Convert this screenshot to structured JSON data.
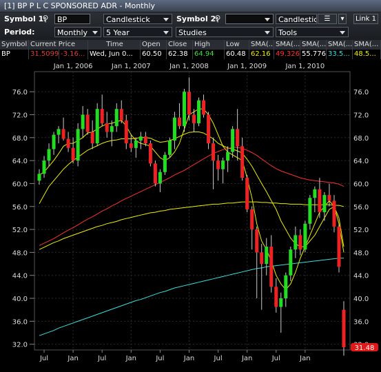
{
  "window": {
    "title": "[1] BP P L C SPONSORED ADR - Monthly"
  },
  "toolbar": {
    "symbol1_label": "Symbol 1:",
    "symbol1_value": "BP",
    "chart_type_1": "Candlestick",
    "symbol2_label": "Symbol 2:",
    "symbol2_value": "",
    "chart_type_2": "Candlestick",
    "link_label": "Link 1",
    "period_label": "Period:",
    "period_value": "Monthly",
    "range_value": "5 Year",
    "studies_label": "Studies",
    "tools_label": "Tools"
  },
  "quote_table": {
    "headers": [
      "Symbol",
      "Current Price",
      "Time",
      "Open",
      "Close",
      "High",
      "Low",
      "SMA(...",
      "SMA(...",
      "SMA(...",
      "SMA(...",
      "SMA(..."
    ],
    "values": [
      "BP",
      "31.5099",
      "-3.16...",
      "Wed, Jun 0...",
      "60.50",
      "62.38",
      "64.94",
      "60.48",
      "62.16",
      "49.326",
      "55.776",
      "33.5...",
      "48.5..."
    ],
    "colors": {
      "price": "#e23b3b",
      "change": "#e23b3b",
      "high": "#3fe03f",
      "sma1": "#f0f000",
      "sma2": "#ff3030",
      "sma4": "#38e0e0",
      "sma5": "#f0f000"
    }
  },
  "chart_data": {
    "type": "candlestick",
    "symbol": "BP",
    "period": "Monthly",
    "top_axis_labels": [
      "Jan 1, 2006",
      "Jan 1, 2007",
      "Jan 1, 2008",
      "Jan 1, 2009",
      "Jan 1, 2010"
    ],
    "bottom_axis_labels": [
      "Jul",
      "Jan",
      "Jul",
      "Jan",
      "Jul",
      "Jan",
      "Jul",
      "Jan",
      "Jul",
      "Jan"
    ],
    "y_ticks": [
      32.0,
      36.0,
      40.0,
      44.0,
      48.0,
      52.0,
      56.0,
      60.0,
      64.0,
      68.0,
      72.0,
      76.0
    ],
    "ylim": [
      31.0,
      79.5
    ],
    "current_price_label": "31.48",
    "grid": true,
    "candles": [
      [
        60.5,
        62.5,
        59.8,
        61.7
      ],
      [
        61.7,
        64.8,
        61.0,
        64.0
      ],
      [
        64.0,
        67.0,
        63.0,
        66.0
      ],
      [
        66.0,
        69.0,
        65.0,
        68.5
      ],
      [
        68.5,
        70.0,
        67.0,
        69.5
      ],
      [
        69.5,
        71.5,
        67.5,
        67.8
      ],
      [
        67.8,
        69.0,
        65.5,
        66.2
      ],
      [
        66.2,
        68.0,
        63.5,
        64.0
      ],
      [
        64.0,
        70.5,
        63.0,
        69.5
      ],
      [
        69.5,
        73.5,
        68.0,
        72.0
      ],
      [
        72.0,
        73.0,
        68.5,
        69.0
      ],
      [
        69.0,
        71.0,
        66.0,
        67.0
      ],
      [
        67.0,
        74.0,
        66.5,
        73.0
      ],
      [
        73.0,
        75.5,
        70.0,
        70.5
      ],
      [
        70.5,
        72.5,
        68.0,
        69.0
      ],
      [
        69.0,
        71.0,
        66.5,
        70.0
      ],
      [
        70.0,
        74.0,
        69.0,
        73.0
      ],
      [
        73.0,
        74.5,
        70.5,
        71.0
      ],
      [
        71.0,
        72.0,
        66.0,
        67.0
      ],
      [
        67.0,
        68.5,
        65.5,
        66.2
      ],
      [
        66.2,
        68.0,
        64.5,
        67.5
      ],
      [
        67.5,
        69.0,
        66.0,
        68.2
      ],
      [
        68.2,
        69.0,
        66.5,
        67.0
      ],
      [
        67.0,
        67.5,
        63.0,
        63.5
      ],
      [
        63.5,
        64.0,
        59.5,
        60.0
      ],
      [
        60.0,
        62.5,
        58.5,
        62.0
      ],
      [
        62.0,
        65.5,
        61.5,
        65.0
      ],
      [
        65.0,
        68.0,
        64.5,
        67.5
      ],
      [
        67.5,
        72.5,
        66.0,
        71.5
      ],
      [
        71.5,
        74.0,
        69.5,
        70.0
      ],
      [
        70.0,
        76.5,
        69.0,
        76.0
      ],
      [
        76.0,
        78.5,
        71.0,
        72.0
      ],
      [
        72.0,
        73.0,
        69.0,
        70.5
      ],
      [
        70.5,
        75.0,
        70.0,
        74.5
      ],
      [
        74.5,
        75.5,
        71.5,
        72.0
      ],
      [
        72.0,
        72.5,
        66.0,
        67.0
      ],
      [
        67.0,
        68.0,
        59.0,
        64.0
      ],
      [
        64.0,
        65.0,
        60.5,
        62.5
      ],
      [
        62.5,
        64.5,
        60.0,
        64.0
      ],
      [
        64.0,
        66.5,
        62.0,
        65.5
      ],
      [
        65.5,
        70.0,
        64.5,
        69.5
      ],
      [
        69.5,
        73.0,
        64.0,
        66.5
      ],
      [
        66.5,
        68.0,
        60.5,
        61.0
      ],
      [
        61.0,
        61.5,
        55.0,
        55.5
      ],
      [
        55.5,
        56.0,
        48.5,
        52.0
      ],
      [
        52.0,
        52.5,
        40.0,
        48.0
      ],
      [
        48.0,
        49.5,
        38.0,
        46.0
      ],
      [
        46.0,
        50.5,
        44.0,
        49.0
      ],
      [
        49.0,
        51.0,
        41.0,
        42.0
      ],
      [
        42.0,
        43.5,
        37.5,
        38.5
      ],
      [
        38.5,
        41.0,
        34.0,
        40.0
      ],
      [
        40.0,
        44.5,
        38.5,
        44.0
      ],
      [
        44.0,
        49.0,
        43.0,
        48.5
      ],
      [
        48.5,
        52.5,
        47.0,
        51.0
      ],
      [
        51.0,
        52.0,
        47.5,
        48.5
      ],
      [
        48.5,
        53.5,
        48.0,
        53.0
      ],
      [
        53.0,
        58.0,
        52.0,
        57.5
      ],
      [
        57.5,
        59.5,
        55.0,
        59.0
      ],
      [
        59.0,
        61.0,
        54.0,
        55.0
      ],
      [
        55.0,
        58.5,
        53.5,
        58.0
      ],
      [
        58.0,
        60.0,
        56.0,
        57.0
      ],
      [
        57.0,
        58.0,
        51.5,
        52.5
      ],
      [
        52.5,
        53.0,
        44.5,
        45.5
      ],
      [
        38.0,
        39.5,
        30.0,
        31.48
      ]
    ],
    "moving_averages": [
      {
        "color": "#f0f000",
        "values": [
          61.5,
          62.0,
          63.0,
          64.0,
          65.2,
          66.5,
          67.0,
          67.0,
          67.5,
          68.0,
          68.8,
          69.0,
          69.5,
          70.0,
          70.4,
          70.5,
          70.8,
          71.0,
          70.0,
          68.5,
          67.5,
          67.0,
          66.8,
          66.5,
          65.5,
          64.5,
          64.0,
          64.5,
          65.5,
          67.0,
          69.5,
          72.0,
          72.5,
          73.0,
          73.0,
          72.0,
          70.5,
          68.5,
          66.5,
          65.5,
          65.0,
          64.5,
          64.0,
          61.0,
          57.5,
          53.0,
          50.0,
          48.5,
          46.5,
          44.0,
          42.5,
          41.5,
          42.5,
          44.5,
          47.0,
          49.0,
          51.0,
          53.0,
          55.0,
          56.0,
          57.0,
          56.0,
          53.0,
          48.0
        ]
      },
      {
        "color": "#f0f000",
        "values": [
          56.5,
          58.0,
          59.5,
          60.5,
          61.5,
          62.5,
          63.3,
          64.0,
          64.6,
          65.2,
          65.8,
          66.2,
          66.6,
          67.0,
          67.3,
          67.5,
          67.6,
          67.8,
          67.8,
          67.8,
          67.9,
          68.0,
          68.0,
          67.9,
          67.5,
          67.2,
          67.3,
          67.5,
          67.8,
          68.2,
          68.6,
          68.9,
          69.0,
          69.0,
          68.8,
          68.3,
          67.8,
          67.0,
          66.6,
          66.2,
          66.0,
          65.7,
          65.3,
          64.2,
          63.0,
          61.5,
          60.0,
          58.6,
          57.0,
          55.5,
          53.5,
          52.0,
          50.5,
          49.5,
          49.0,
          49.0,
          50.0,
          51.0,
          52.5,
          54.0,
          55.5,
          56.0,
          54.0,
          49.0
        ]
      },
      {
        "color": "#ff3030",
        "values": [
          49.2,
          49.6,
          50.0,
          50.4,
          50.9,
          51.4,
          51.9,
          52.3,
          52.8,
          53.3,
          53.8,
          54.2,
          54.7,
          55.2,
          55.6,
          56.1,
          56.5,
          57.0,
          57.4,
          57.8,
          58.2,
          58.6,
          59.0,
          59.4,
          59.8,
          60.2,
          60.6,
          61.0,
          61.5,
          61.9,
          62.3,
          62.8,
          63.3,
          63.8,
          64.3,
          64.8,
          65.2,
          65.6,
          65.9,
          66.1,
          66.3,
          66.3,
          66.1,
          65.8,
          65.4,
          64.9,
          64.3,
          63.7,
          63.1,
          62.6,
          62.2,
          61.9,
          61.6,
          61.3,
          61.0,
          60.8,
          60.6,
          60.5,
          60.4,
          60.3,
          60.2,
          60.1,
          59.9,
          59.5
        ]
      },
      {
        "color": "#f0f000",
        "values": [
          48.5,
          48.9,
          49.3,
          49.7,
          50.0,
          50.4,
          50.7,
          51.0,
          51.3,
          51.6,
          51.9,
          52.2,
          52.5,
          52.7,
          53.0,
          53.2,
          53.4,
          53.7,
          53.9,
          54.1,
          54.3,
          54.5,
          54.7,
          54.9,
          55.0,
          55.2,
          55.3,
          55.5,
          55.6,
          55.7,
          55.8,
          55.9,
          56.0,
          56.1,
          56.2,
          56.3,
          56.4,
          56.4,
          56.5,
          56.6,
          56.6,
          56.7,
          56.8,
          56.8,
          56.8,
          56.8,
          56.7,
          56.7,
          56.6,
          56.6,
          56.5,
          56.5,
          56.4,
          56.4,
          56.4,
          56.3,
          56.3,
          56.3,
          56.3,
          56.3,
          56.3,
          56.2,
          56.2,
          56.0
        ]
      },
      {
        "color": "#38e0e0",
        "values": [
          33.5,
          33.8,
          34.1,
          34.4,
          34.8,
          35.1,
          35.4,
          35.7,
          36.0,
          36.3,
          36.6,
          36.9,
          37.2,
          37.5,
          37.8,
          38.1,
          38.4,
          38.7,
          39.0,
          39.3,
          39.6,
          39.8,
          40.1,
          40.4,
          40.7,
          41.0,
          41.2,
          41.5,
          41.8,
          42.0,
          42.2,
          42.4,
          42.6,
          42.8,
          43.0,
          43.2,
          43.4,
          43.6,
          43.8,
          44.0,
          44.2,
          44.4,
          44.6,
          44.8,
          45.0,
          45.2,
          45.3,
          45.5,
          45.6,
          45.7,
          45.8,
          45.9,
          46.0,
          46.1,
          46.2,
          46.3,
          46.4,
          46.5,
          46.6,
          46.7,
          46.8,
          46.9,
          47.0,
          47.0
        ]
      }
    ]
  }
}
